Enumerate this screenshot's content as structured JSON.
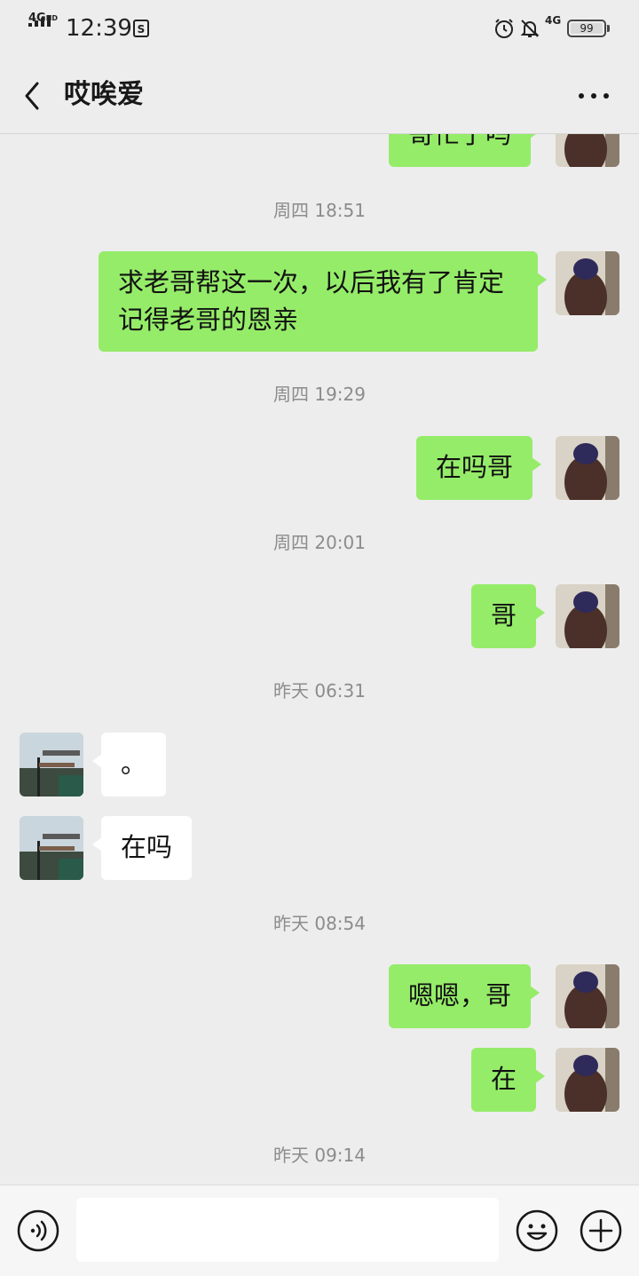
{
  "status_bar": {
    "network_label": "4G",
    "network_hd": "HD",
    "time": "12:39",
    "right_network": "4G",
    "battery": "99"
  },
  "header": {
    "title": "哎唉爱"
  },
  "messages": [
    {
      "type": "sent",
      "text": "哥忙了吗"
    },
    {
      "type": "time",
      "text": "周四 18:51"
    },
    {
      "type": "sent",
      "text": "求老哥帮这一次，以后我有了肯定记得老哥的恩亲"
    },
    {
      "type": "time",
      "text": "周四 19:29"
    },
    {
      "type": "sent",
      "text": "在吗哥"
    },
    {
      "type": "time",
      "text": "周四 20:01"
    },
    {
      "type": "sent",
      "text": "哥"
    },
    {
      "type": "time",
      "text": "昨天 06:31"
    },
    {
      "type": "recv",
      "text": "。"
    },
    {
      "type": "recv",
      "text": "在吗"
    },
    {
      "type": "time",
      "text": "昨天 08:54"
    },
    {
      "type": "sent",
      "text": "嗯嗯，哥"
    },
    {
      "type": "sent",
      "text": "在"
    },
    {
      "type": "time",
      "text": "昨天 09:14"
    }
  ],
  "input_bar": {
    "value": ""
  },
  "icons": {
    "back": "chevron-left-icon",
    "more": "more-dots-icon",
    "voice": "voice-icon",
    "emoji": "emoji-icon",
    "plus": "plus-icon",
    "alarm": "alarm-icon",
    "bell_off": "bell-off-icon"
  },
  "colors": {
    "sent_bubble": "#95ec69",
    "recv_bubble": "#ffffff",
    "background": "#ededed"
  }
}
